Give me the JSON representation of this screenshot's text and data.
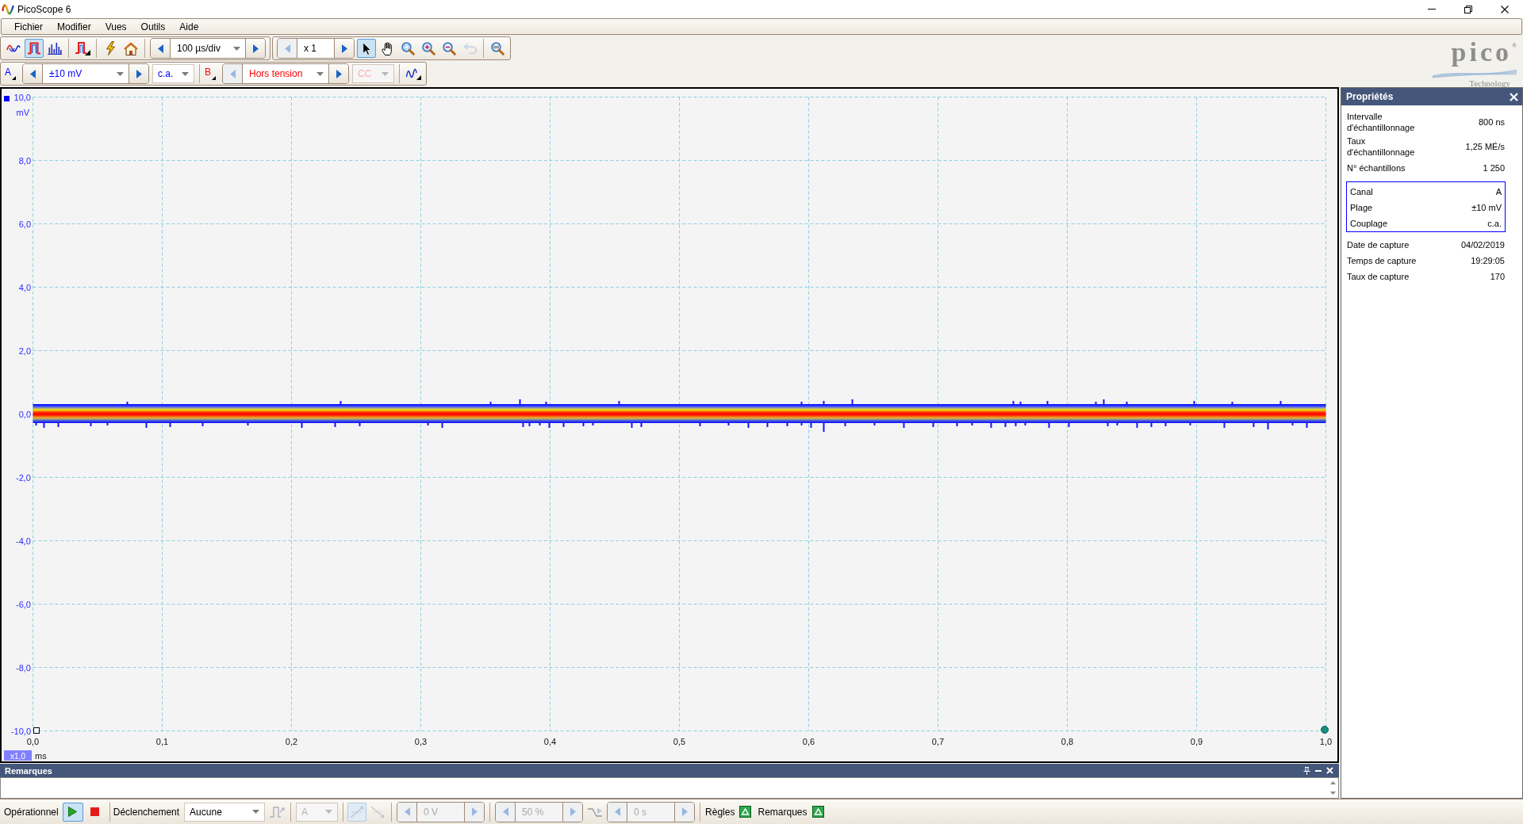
{
  "window": {
    "title": "PicoScope 6"
  },
  "menu": [
    "Fichier",
    "Modifier",
    "Vues",
    "Outils",
    "Aide"
  ],
  "toolbar": {
    "modes": [
      {
        "kind": "scope",
        "selected": false
      },
      {
        "kind": "persistence",
        "selected": true
      },
      {
        "kind": "spectrum",
        "selected": false
      }
    ],
    "timebase": {
      "value": "100 µs/div"
    },
    "zoom": {
      "value": "x 1",
      "decrement_disabled": true
    },
    "tools": [
      {
        "kind": "pointer",
        "selected": true,
        "disabled": false
      },
      {
        "kind": "hand",
        "selected": false,
        "disabled": false
      },
      {
        "kind": "zoom-area",
        "selected": false,
        "disabled": false
      },
      {
        "kind": "zoom-in",
        "selected": false,
        "disabled": false
      },
      {
        "kind": "zoom-out",
        "selected": false,
        "disabled": false
      },
      {
        "kind": "undo-zoom",
        "selected": false,
        "disabled": true
      }
    ]
  },
  "channels": [
    {
      "label": "A",
      "color": "#0000ff",
      "range": "±10 mV",
      "range_decrement_disabled": false,
      "coupling": "c.a.",
      "coupling_disabled": false
    },
    {
      "label": "B",
      "color": "#ff0000",
      "range": "Hors tension",
      "range_decrement_disabled": true,
      "coupling": "CC",
      "coupling_disabled": true
    }
  ],
  "logo": {
    "wordmark": "pico$^{®}$",
    "tagline": "Technology"
  },
  "scope": {
    "y_ticks": [
      "10,0",
      "8,0",
      "6,0",
      "4,0",
      "2,0",
      "0,0",
      "-2,0",
      "-4,0",
      "-6,0",
      "-8,0",
      "-10,0"
    ],
    "y_unit": "mV",
    "x_ticks": [
      "0,0",
      "0,1",
      "0,2",
      "0,3",
      "0,4",
      "0,5",
      "0,6",
      "0,7",
      "0,8",
      "0,9",
      "1,0"
    ],
    "x_scale": "x1,0",
    "x_unit": "ms"
  },
  "remarks": {
    "title": "Remarques"
  },
  "properties": {
    "title": "Propriétés",
    "rows": [
      {
        "label": "Intervalle d'échantillonnage",
        "value": "800 ns"
      },
      {
        "label": "Taux d'échantillonnage",
        "value": "1,25 MÉ/s"
      },
      {
        "label": "N° échantillons",
        "value": "1 250"
      }
    ],
    "channel_group": [
      {
        "label": "Canal",
        "value": "A"
      },
      {
        "label": "Plage",
        "value": "±10 mV"
      },
      {
        "label": "Couplage",
        "value": "c.a."
      }
    ],
    "capture_rows": [
      {
        "label": "Date de capture",
        "value": "04/02/2019"
      },
      {
        "label": "Temps de capture",
        "value": "19:29:05"
      },
      {
        "label": "Taux de capture",
        "value": "170"
      }
    ]
  },
  "status_bar": {
    "run_label": "Opérationnel",
    "run_controls": [
      {
        "kind": "start",
        "selected": true
      },
      {
        "kind": "stop",
        "selected": false
      }
    ],
    "trigger_label": "Déclenchement",
    "trigger_mode": "Aucune",
    "trigger_channel": {
      "value": "A",
      "disabled": true
    },
    "edges": [
      {
        "kind": "rising",
        "selected": true,
        "disabled": true
      },
      {
        "kind": "falling",
        "selected": false,
        "disabled": true
      }
    ],
    "threshold": {
      "value": "0 V",
      "disabled": true
    },
    "pre_trigger": {
      "value": "50 %",
      "disabled": true
    },
    "delay": {
      "value": "0 s",
      "disabled": true
    },
    "toggles": [
      {
        "label": "Règles"
      },
      {
        "label": "Remarques"
      }
    ]
  }
}
